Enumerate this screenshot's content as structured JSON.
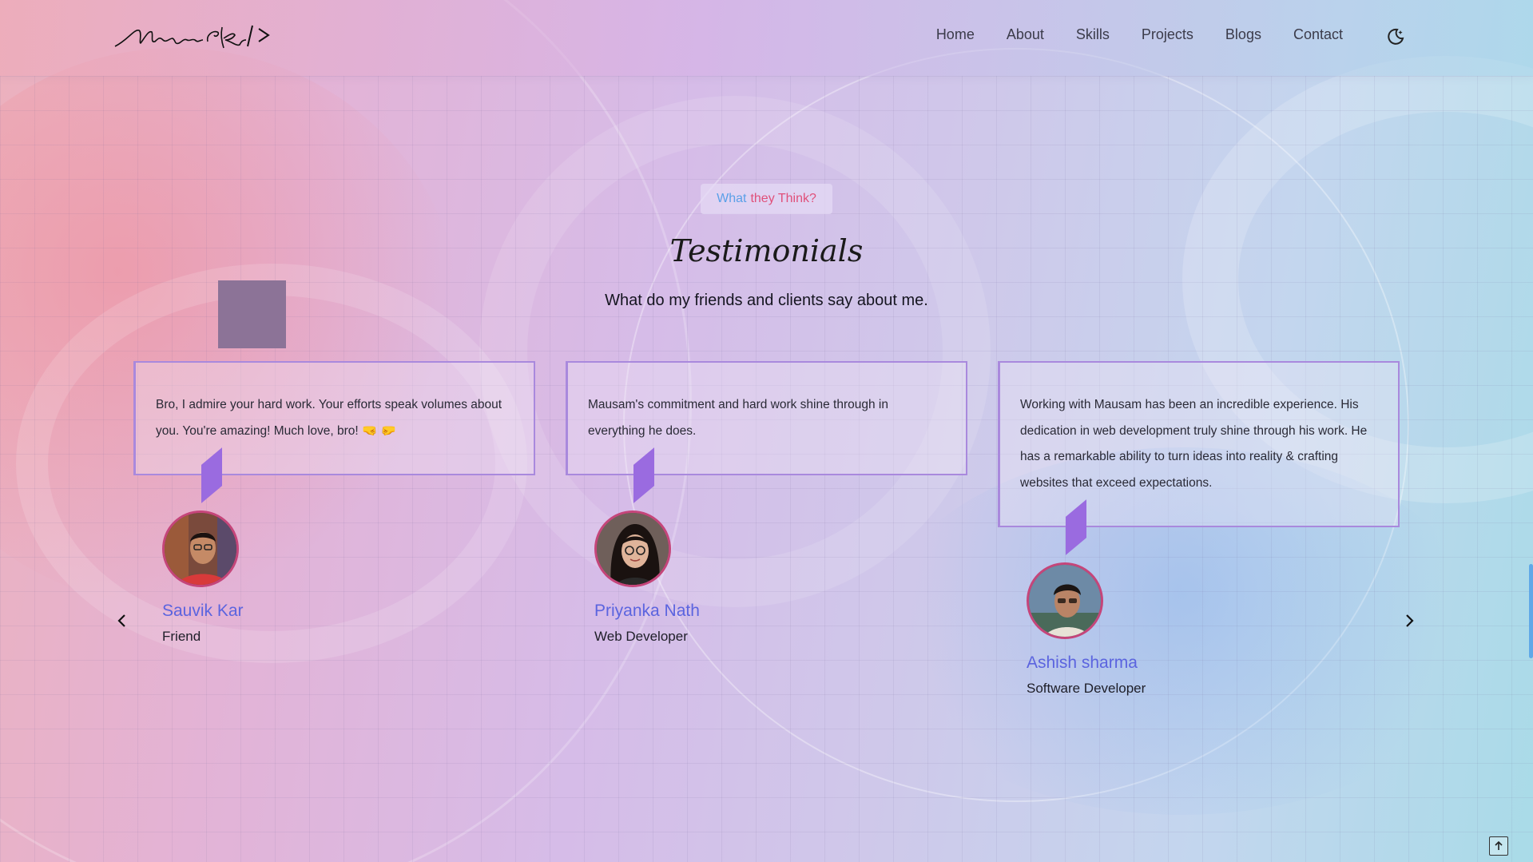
{
  "header": {
    "logo_text": "Mausam Kar />",
    "nav": [
      "Home",
      "About",
      "Skills",
      "Projects",
      "Blogs",
      "Contact"
    ],
    "theme_toggle_icon": "moon-icon"
  },
  "section": {
    "eyebrow_part1": "What",
    "eyebrow_part2": "they Think?",
    "title": "Testimonials",
    "subtitle": "What do my friends and clients say about me."
  },
  "testimonials": [
    {
      "quote": "Bro, I admire your hard work. Your efforts speak volumes about you. You're amazing! Much love, bro! 🤜 🤛",
      "name": "Sauvik Kar",
      "role": "Friend"
    },
    {
      "quote": "Mausam's commitment and hard work shine through in everything he does.",
      "name": "Priyanka Nath",
      "role": "Web Developer"
    },
    {
      "quote": "Working with Mausam has been an incredible experience. His dedication in web development truly shine through his work. He has a remarkable ability to turn ideas into reality & crafting websites that exceed expectations.",
      "name": "Ashish sharma",
      "role": "Software Developer"
    }
  ],
  "controls": {
    "prev_icon": "chevron-left-icon",
    "next_icon": "chevron-right-icon",
    "scroll_top_icon": "arrow-up-icon"
  },
  "colors": {
    "accent_purple": "#9a6be0",
    "card_border": "#a989dd",
    "name_blue": "#5b64df",
    "avatar_border": "#c5457a",
    "eyebrow_blue": "#5aa0e8",
    "eyebrow_pink": "#e0507a"
  }
}
